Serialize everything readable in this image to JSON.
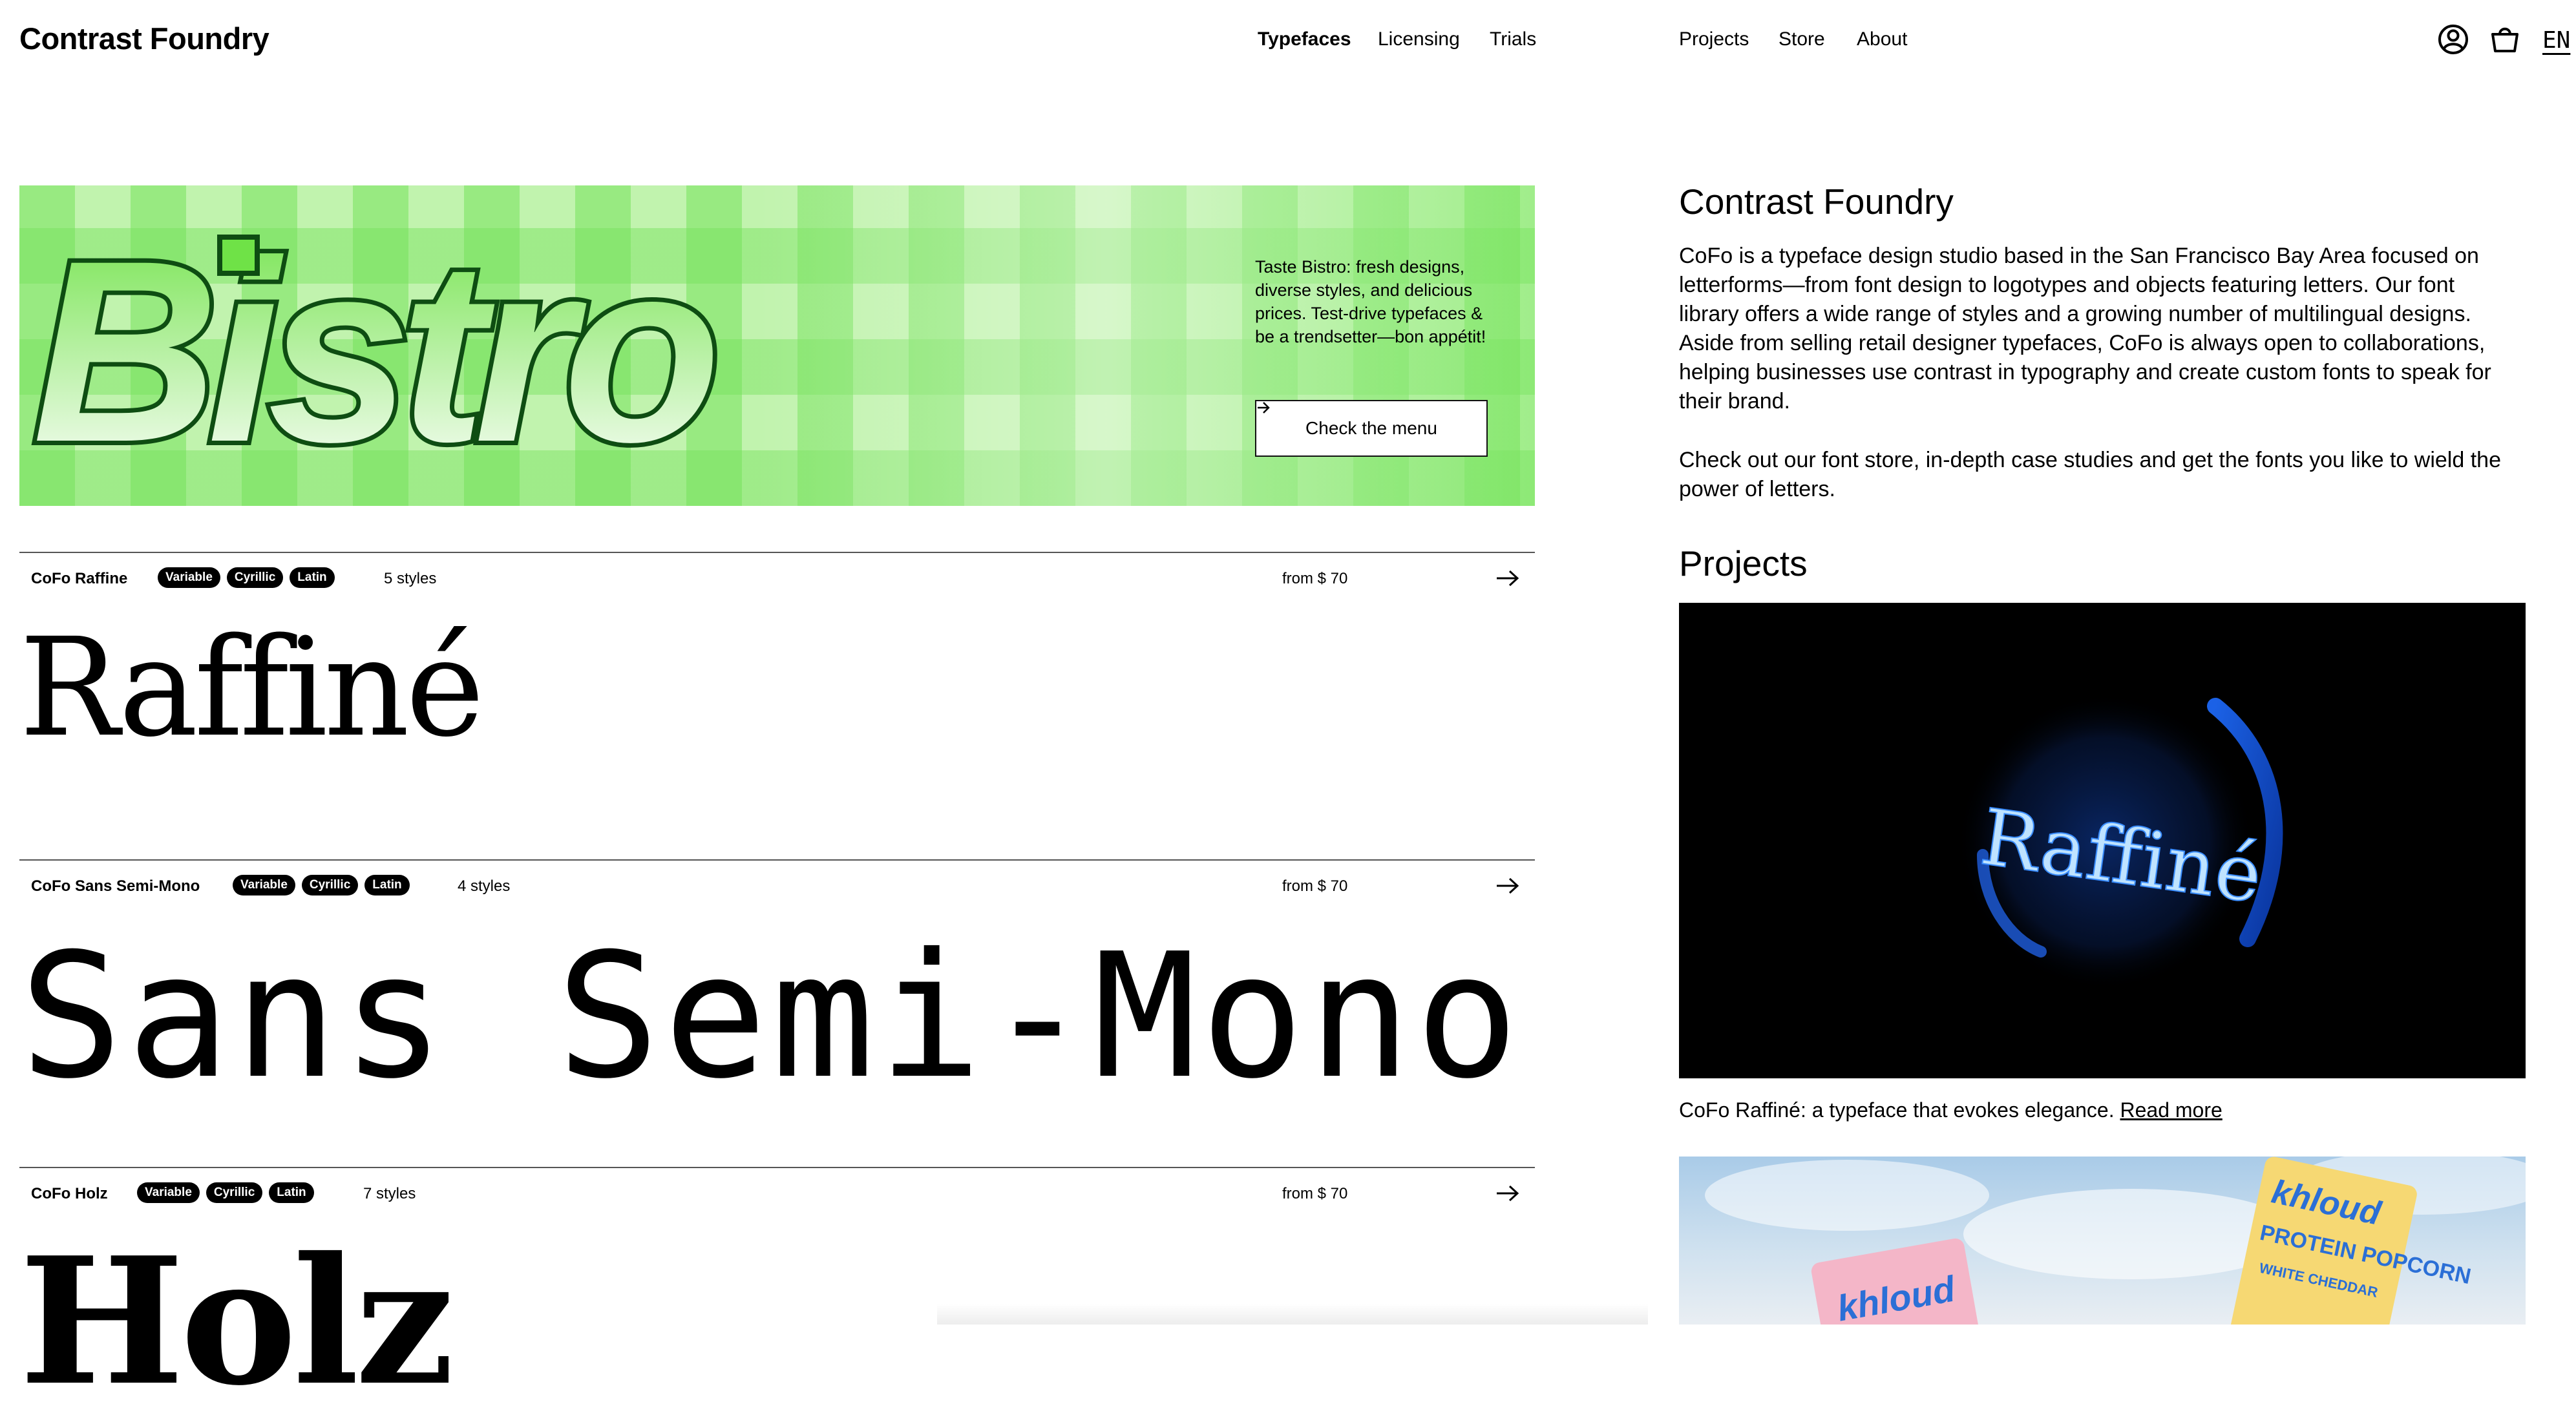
{
  "header": {
    "logo": "Contrast Foundry",
    "nav_left": [
      "Typefaces",
      "Licensing",
      "Trials"
    ],
    "nav_right": [
      "Projects",
      "Store",
      "About"
    ],
    "language": "EN",
    "icons": [
      "account-icon",
      "cart-icon"
    ]
  },
  "banner": {
    "art_text": "Bistro",
    "description": "Taste Bistro: fresh designs, diverse styles, and delicious prices. Test-drive typefaces & be a trendsetter—bon appétit!",
    "button_label": "Check the menu",
    "colors": {
      "dark_green": "#0e4d12",
      "bright_green": "#6fe247",
      "light_green": "#c1f3ae"
    }
  },
  "fonts": [
    {
      "name": "CoFo Raffine",
      "badges": [
        "Variable",
        "Cyrillic",
        "Latin"
      ],
      "styles": "5 styles",
      "price": "from $ 70",
      "specimen": "Raffiné"
    },
    {
      "name": "CoFo Sans Semi-Mono",
      "badges": [
        "Variable",
        "Cyrillic",
        "Latin"
      ],
      "styles": "4 styles",
      "price": "from $ 70",
      "specimen": "Sans Semi-Mono"
    },
    {
      "name": "CoFo Holz",
      "badges": [
        "Variable",
        "Cyrillic",
        "Latin"
      ],
      "styles": "7 styles",
      "price": "from $ 70",
      "specimen": "Holz"
    }
  ],
  "about": {
    "title": "Contrast Foundry",
    "paragraph1": "CoFo is a typeface design studio based in the San Francisco Bay Area focused on letterforms—from font design to logotypes and objects featuring letters. Our font library offers a wide range of styles and a growing number of multilingual designs. Aside from selling retail designer typefaces, CoFo is always open to collaborations, helping businesses use contrast in typography and create custom fonts to speak for their brand.",
    "paragraph2": "Check out our font store, in-depth case studies and get the fonts you like to wield the power of letters."
  },
  "projects": {
    "title": "Projects",
    "items": [
      {
        "image_text": "Raffiné",
        "caption": "CoFo Raffiné: a typeface that evokes elegance.",
        "link": "Read more"
      },
      {
        "image_text_brand": "khloud",
        "image_text_product": "PROTEIN POPCORN",
        "image_text_flavor": "WHITE CHEDDAR"
      }
    ]
  }
}
